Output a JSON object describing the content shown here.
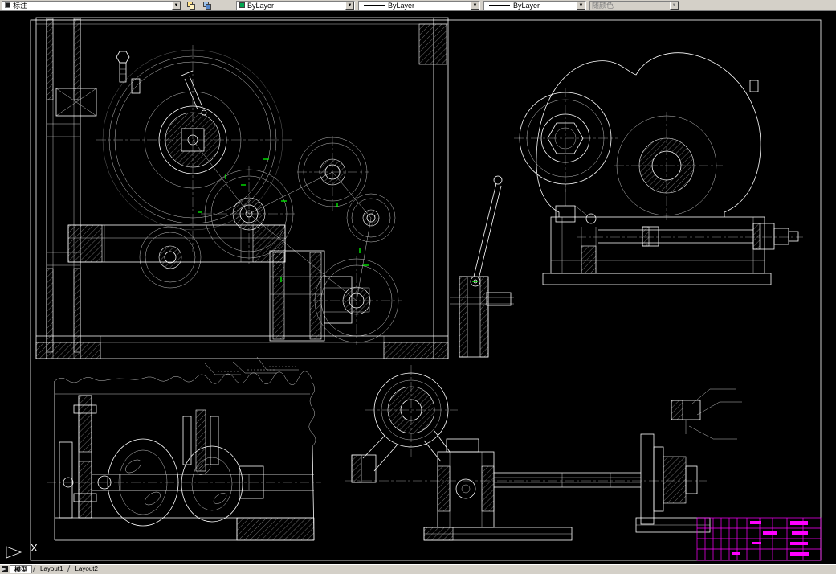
{
  "toolbar": {
    "layer_combo": {
      "value": "标注"
    },
    "color_combo": {
      "value": "ByLayer"
    },
    "linetype_combo": {
      "value": "ByLayer"
    },
    "lineweight_combo": {
      "value": "ByLayer"
    },
    "plot_style_combo": {
      "value": "随颜色"
    },
    "arrow_glyph": "▼"
  },
  "canvas": {
    "ucs_axis_label": "X"
  },
  "statusbar": {
    "tabs": [
      {
        "label": "模型"
      },
      {
        "label": "Layout1"
      },
      {
        "label": "Layout2"
      }
    ]
  },
  "colors": {
    "canvas_bg": "#000000",
    "line": "#ffffff",
    "hatch": "#d8d8d8",
    "accent_green": "#00ff00",
    "title_block_magenta": "#ff00ff",
    "toolbar_bg": "#d4d0c8",
    "layer_swatch": "#202020",
    "color_swatch": "#00a550"
  }
}
